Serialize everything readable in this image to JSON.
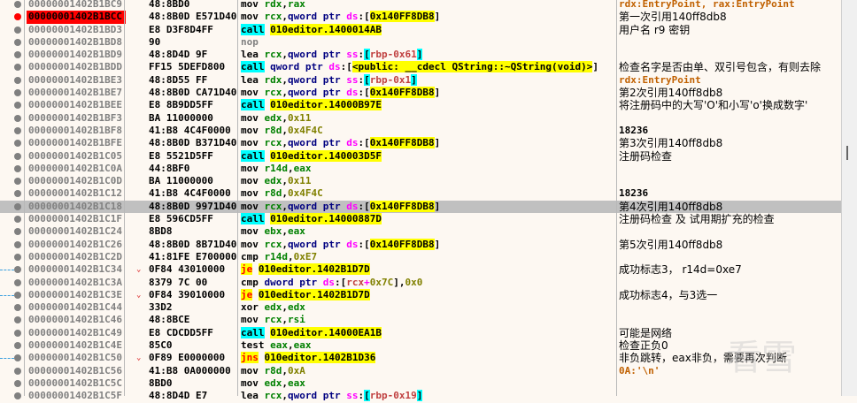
{
  "rows": [
    {
      "addr": "00000001402B1BC9",
      "bytes": "48:8BD0",
      "ins": [
        [
          "m",
          "mov "
        ],
        [
          "reg",
          "rdx"
        ],
        [
          "p",
          ","
        ],
        [
          "reg",
          "rax"
        ]
      ],
      "comment": "rdx:EntryPoint, rax:EntryPoint",
      "ctype": "auto"
    },
    {
      "addr": "00000001402B1BCC",
      "bytes": "48:8B0D E571D40",
      "bp": true,
      "ins": [
        [
          "m",
          "mov "
        ],
        [
          "reg",
          "rcx"
        ],
        [
          "p",
          ","
        ],
        [
          "ptr",
          "qword ptr "
        ],
        [
          "seg",
          "ds"
        ],
        [
          "p",
          ":["
        ],
        [
          "addr",
          "0x140FF8DB8"
        ],
        [
          "p",
          "]"
        ]
      ],
      "comment": "第一次引用140ff8db8"
    },
    {
      "addr": "00000001402B1BD3",
      "bytes": "E8 D3F8D4FF",
      "ins": [
        [
          "call",
          "call"
        ],
        [
          "p",
          " "
        ],
        [
          "addr",
          "010editor.1400014AB"
        ]
      ],
      "comment": "用户名 r9 密钥"
    },
    {
      "addr": "00000001402B1BD8",
      "bytes": "90",
      "ins": [
        [
          "nop",
          "nop"
        ]
      ]
    },
    {
      "addr": "00000001402B1BD9",
      "bytes": "48:8D4D 9F",
      "ins": [
        [
          "m",
          "lea "
        ],
        [
          "reg",
          "rcx"
        ],
        [
          "p",
          ","
        ],
        [
          "ptr",
          "qword ptr "
        ],
        [
          "seg",
          "ss"
        ],
        [
          "p",
          ":"
        ],
        [
          "cy",
          "["
        ],
        [
          "stk",
          "rbp-0x61"
        ],
        [
          "cy",
          "]"
        ]
      ]
    },
    {
      "addr": "00000001402B1BDD",
      "bytes": "FF15 5DEFD800",
      "ins": [
        [
          "call",
          "call"
        ],
        [
          "p",
          " "
        ],
        [
          "ptr",
          "qword ptr "
        ],
        [
          "seg",
          "ds"
        ],
        [
          "p",
          ":["
        ],
        [
          "addr",
          "<public: __cdecl QString::~QString(void)>"
        ],
        [
          "p",
          "]"
        ]
      ],
      "comment": "检查名字是否由单、双引号包含，有则去除"
    },
    {
      "addr": "00000001402B1BE3",
      "bytes": "48:8D55 FF",
      "ins": [
        [
          "m",
          "lea "
        ],
        [
          "reg",
          "rdx"
        ],
        [
          "p",
          ","
        ],
        [
          "ptr",
          "qword ptr "
        ],
        [
          "seg",
          "ss"
        ],
        [
          "p",
          ":"
        ],
        [
          "cy",
          "["
        ],
        [
          "stk",
          "rbp-0x1"
        ],
        [
          "cy",
          "]"
        ]
      ],
      "comment": "rdx:EntryPoint",
      "ctype": "auto"
    },
    {
      "addr": "00000001402B1BE7",
      "bytes": "48:8B0D CA71D40",
      "ins": [
        [
          "m",
          "mov "
        ],
        [
          "reg",
          "rcx"
        ],
        [
          "p",
          ","
        ],
        [
          "ptr",
          "qword ptr "
        ],
        [
          "seg",
          "ds"
        ],
        [
          "p",
          ":["
        ],
        [
          "addr",
          "0x140FF8DB8"
        ],
        [
          "p",
          "]"
        ]
      ],
      "comment": "第2次引用140ff8db8"
    },
    {
      "addr": "00000001402B1BEE",
      "bytes": "E8 8B9DD5FF",
      "ins": [
        [
          "call",
          "call"
        ],
        [
          "p",
          " "
        ],
        [
          "addr",
          "010editor.14000B97E"
        ]
      ],
      "comment": "将注册码中的大写'O'和小写'o'换成数字'"
    },
    {
      "addr": "00000001402B1BF3",
      "bytes": "BA 11000000",
      "ins": [
        [
          "m",
          "mov "
        ],
        [
          "reg",
          "edx"
        ],
        [
          "p",
          ","
        ],
        [
          "num",
          "0x11"
        ]
      ]
    },
    {
      "addr": "00000001402B1BF8",
      "bytes": "41:B8 4C4F0000",
      "ins": [
        [
          "m",
          "mov "
        ],
        [
          "reg",
          "r8d"
        ],
        [
          "p",
          ","
        ],
        [
          "num",
          "0x4F4C"
        ]
      ],
      "comment": "18236",
      "ctype": "num"
    },
    {
      "addr": "00000001402B1BFE",
      "bytes": "48:8B0D B371D40",
      "ins": [
        [
          "m",
          "mov "
        ],
        [
          "reg",
          "rcx"
        ],
        [
          "p",
          ","
        ],
        [
          "ptr",
          "qword ptr "
        ],
        [
          "seg",
          "ds"
        ],
        [
          "p",
          ":["
        ],
        [
          "addr",
          "0x140FF8DB8"
        ],
        [
          "p",
          "]"
        ]
      ],
      "comment": "第3次引用140ff8db8"
    },
    {
      "addr": "00000001402B1C05",
      "bytes": "E8 5521D5FF",
      "ins": [
        [
          "call",
          "call"
        ],
        [
          "p",
          " "
        ],
        [
          "addr",
          "010editor.140003D5F"
        ]
      ],
      "comment": "注册码检查"
    },
    {
      "addr": "00000001402B1C0A",
      "bytes": "44:8BF0",
      "ins": [
        [
          "m",
          "mov "
        ],
        [
          "reg",
          "r14d"
        ],
        [
          "p",
          ","
        ],
        [
          "reg",
          "eax"
        ]
      ]
    },
    {
      "addr": "00000001402B1C0D",
      "bytes": "BA 11000000",
      "ins": [
        [
          "m",
          "mov "
        ],
        [
          "reg",
          "edx"
        ],
        [
          "p",
          ","
        ],
        [
          "num",
          "0x11"
        ]
      ]
    },
    {
      "addr": "00000001402B1C12",
      "bytes": "41:B8 4C4F0000",
      "ins": [
        [
          "m",
          "mov "
        ],
        [
          "reg",
          "r8d"
        ],
        [
          "p",
          ","
        ],
        [
          "num",
          "0x4F4C"
        ]
      ],
      "comment": "18236",
      "ctype": "num"
    },
    {
      "addr": "00000001402B1C18",
      "bytes": "48:8B0D 9971D40",
      "sel": true,
      "ins": [
        [
          "m",
          "mov "
        ],
        [
          "reg",
          "rcx"
        ],
        [
          "p",
          ","
        ],
        [
          "ptr",
          "qword ptr "
        ],
        [
          "seg",
          "ds"
        ],
        [
          "p",
          ":["
        ],
        [
          "addr",
          "0x140FF8DB8"
        ],
        [
          "p",
          "]"
        ]
      ],
      "comment": "第4次引用140ff8db8"
    },
    {
      "addr": "00000001402B1C1F",
      "bytes": "E8 596CD5FF",
      "ins": [
        [
          "call",
          "call"
        ],
        [
          "p",
          " "
        ],
        [
          "addr",
          "010editor.14000887D"
        ]
      ],
      "comment": "注册码检查 及 试用期扩充的检查"
    },
    {
      "addr": "00000001402B1C24",
      "bytes": "8BD8",
      "ins": [
        [
          "m",
          "mov "
        ],
        [
          "reg",
          "ebx"
        ],
        [
          "p",
          ","
        ],
        [
          "reg",
          "eax"
        ]
      ]
    },
    {
      "addr": "00000001402B1C26",
      "bytes": "48:8B0D 8B71D40",
      "ins": [
        [
          "m",
          "mov "
        ],
        [
          "reg",
          "rcx"
        ],
        [
          "p",
          ","
        ],
        [
          "ptr",
          "qword ptr "
        ],
        [
          "seg",
          "ds"
        ],
        [
          "p",
          ":["
        ],
        [
          "addr",
          "0x140FF8DB8"
        ],
        [
          "p",
          "]"
        ]
      ],
      "comment": "第5次引用140ff8db8"
    },
    {
      "addr": "00000001402B1C2D",
      "bytes": "41:81FE E700000",
      "ins": [
        [
          "m",
          "cmp "
        ],
        [
          "reg",
          "r14d"
        ],
        [
          "p",
          ","
        ],
        [
          "num",
          "0xE7"
        ]
      ]
    },
    {
      "addr": "00000001402B1C34",
      "bytes": "0F84 43010000",
      "jump": true,
      "ins": [
        [
          "jmp",
          "je"
        ],
        [
          "p",
          " "
        ],
        [
          "addr",
          "010editor.1402B1D7D"
        ]
      ],
      "comment": "成功标志3，  r14d=0xe7"
    },
    {
      "addr": "00000001402B1C3A",
      "bytes": "8379 7C 00",
      "ins": [
        [
          "m",
          "cmp "
        ],
        [
          "ptr",
          "dword ptr "
        ],
        [
          "seg",
          "ds"
        ],
        [
          "p",
          ":["
        ],
        [
          "stk",
          "rcx"
        ],
        [
          "seg",
          "+"
        ],
        [
          "num",
          "0x7C"
        ],
        [
          "p",
          "],"
        ],
        [
          "num",
          "0x0"
        ]
      ]
    },
    {
      "addr": "00000001402B1C3E",
      "bytes": "0F84 39010000",
      "jump": true,
      "ins": [
        [
          "jmp",
          "je"
        ],
        [
          "p",
          " "
        ],
        [
          "addr",
          "010editor.1402B1D7D"
        ]
      ],
      "comment": "成功标志4，与3选一"
    },
    {
      "addr": "00000001402B1C44",
      "bytes": "33D2",
      "ins": [
        [
          "m",
          "xor "
        ],
        [
          "reg",
          "edx"
        ],
        [
          "p",
          ","
        ],
        [
          "reg",
          "edx"
        ]
      ]
    },
    {
      "addr": "00000001402B1C46",
      "bytes": "48:8BCE",
      "ins": [
        [
          "m",
          "mov "
        ],
        [
          "reg",
          "rcx"
        ],
        [
          "p",
          ","
        ],
        [
          "reg",
          "rsi"
        ]
      ]
    },
    {
      "addr": "00000001402B1C49",
      "bytes": "E8 CDCDD5FF",
      "ins": [
        [
          "call",
          "call"
        ],
        [
          "p",
          " "
        ],
        [
          "addr",
          "010editor.14000EA1B"
        ]
      ],
      "comment": "可能是网络"
    },
    {
      "addr": "00000001402B1C4E",
      "bytes": "85C0",
      "ins": [
        [
          "m",
          "test "
        ],
        [
          "reg",
          "eax"
        ],
        [
          "p",
          ","
        ],
        [
          "reg",
          "eax"
        ]
      ],
      "comment": "检查正负0"
    },
    {
      "addr": "00000001402B1C50",
      "bytes": "0F89 E0000000",
      "jump": true,
      "ins": [
        [
          "jmp",
          "jns"
        ],
        [
          "p",
          " "
        ],
        [
          "addr",
          "010editor.1402B1D36"
        ]
      ],
      "comment": "非负跳转，eax非负，需要再次判断"
    },
    {
      "addr": "00000001402B1C56",
      "bytes": "41:B8 0A000000",
      "ins": [
        [
          "m",
          "mov "
        ],
        [
          "reg",
          "r8d"
        ],
        [
          "p",
          ","
        ],
        [
          "num",
          "0xA"
        ]
      ],
      "comment": "0A:'\\n'",
      "ctype": "auto"
    },
    {
      "addr": "00000001402B1C5C",
      "bytes": "8BD0",
      "ins": [
        [
          "m",
          "mov "
        ],
        [
          "reg",
          "edx"
        ],
        [
          "p",
          ","
        ],
        [
          "reg",
          "eax"
        ]
      ]
    },
    {
      "addr": "00000001402B1C5F",
      "bytes": "48:8D4D E7",
      "ins": [
        [
          "m",
          "lea "
        ],
        [
          "reg",
          "rcx"
        ],
        [
          "p",
          ","
        ],
        [
          "ptr",
          "qword ptr "
        ],
        [
          "seg",
          "ss"
        ],
        [
          "p",
          ":"
        ],
        [
          "cy",
          "["
        ],
        [
          "stk",
          "rbp-0x19"
        ],
        [
          "cy",
          "]"
        ]
      ]
    }
  ],
  "watermark": "看雪",
  "colors": {
    "breakpoint": "#ff0000",
    "call_bg": "#00ffff",
    "addr_bg": "#ffff00",
    "register": "#008000",
    "selected": "#c0c0c0"
  }
}
